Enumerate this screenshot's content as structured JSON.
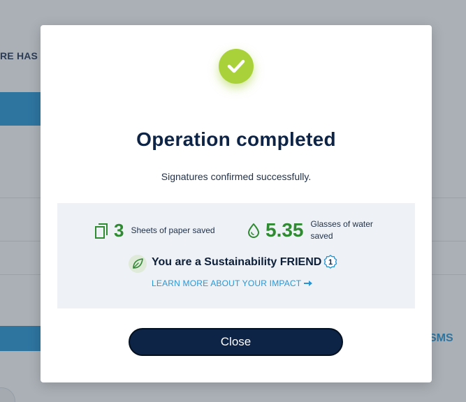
{
  "background": {
    "heading_fragment": "RE HAS B",
    "sms_label": "SMS"
  },
  "modal": {
    "title": "Operation completed",
    "message": "Signatures confirmed successfully.",
    "icons": {
      "success": "checkmark-icon"
    },
    "colors": {
      "success_green": "#a9d23a",
      "stat_green": "#2f8a32",
      "navy": "#0d2447",
      "link_blue": "#2a95d3",
      "panel_bg": "#eef2f6"
    },
    "impact": {
      "paper": {
        "icon": "copy-pages-icon",
        "value": "3",
        "label": "Sheets of paper saved"
      },
      "water": {
        "icon": "water-drop-icon",
        "value": "5.35",
        "label": "Glasses of water saved"
      },
      "friend_text": "You are a Sustainability FRIEND",
      "level": "1",
      "learn_more": "LEARN MORE ABOUT YOUR IMPACT"
    },
    "close_label": "Close"
  }
}
